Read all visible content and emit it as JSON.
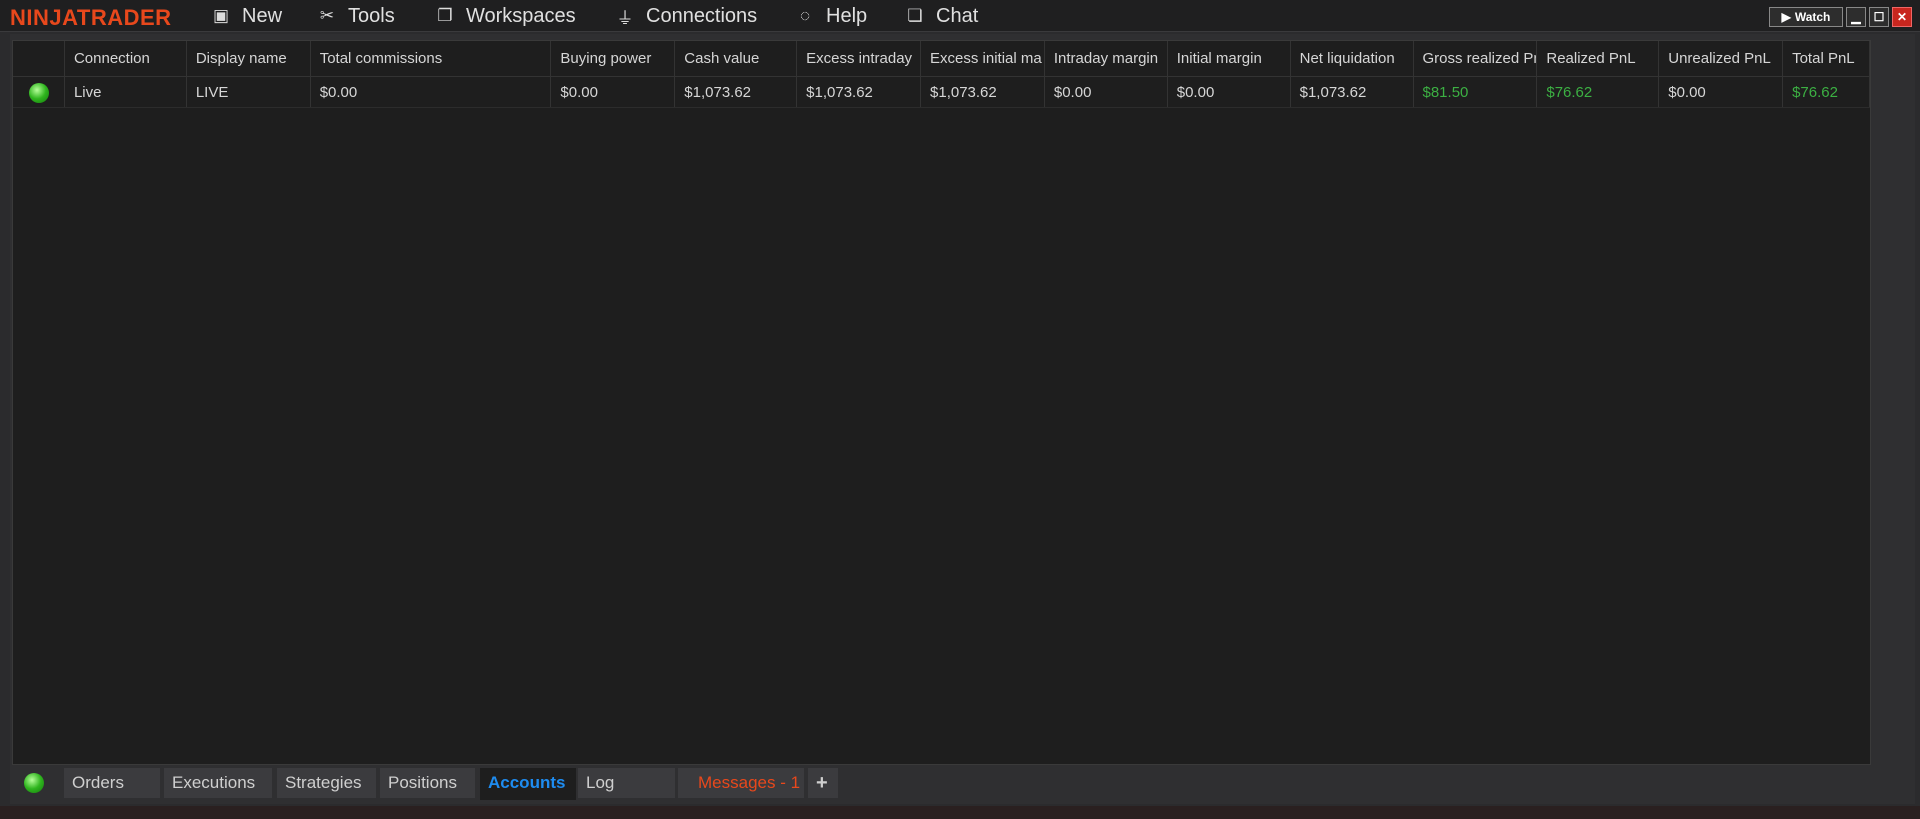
{
  "app": {
    "logo": "NINJATRADER"
  },
  "menu": [
    {
      "label": "New",
      "icon": "new-window-icon"
    },
    {
      "label": "Tools",
      "icon": "tools-icon"
    },
    {
      "label": "Workspaces",
      "icon": "workspaces-icon"
    },
    {
      "label": "Connections",
      "icon": "plug-icon"
    },
    {
      "label": "Help",
      "icon": "lifebuoy-icon"
    },
    {
      "label": "Chat",
      "icon": "chat-icon"
    }
  ],
  "window": {
    "watch_label": "Watch"
  },
  "table": {
    "columns": [
      "",
      "Connection",
      "Display name",
      "Total commissions",
      "Buying power",
      "Cash value",
      "Excess intraday",
      "Excess initial ma",
      "Intraday margin",
      "Initial margin",
      "Net liquidation",
      "Gross realized PnL",
      "Realized PnL",
      "Unrealized PnL",
      "Total PnL"
    ],
    "rows": [
      {
        "status": "connected",
        "cells": [
          "",
          "Live",
          "LIVE",
          "$0.00",
          "$0.00",
          "$1,073.62",
          "$1,073.62",
          "$1,073.62",
          "$0.00",
          "$0.00",
          "$1,073.62",
          "$81.50",
          "$76.62",
          "$0.00",
          "$76.62"
        ]
      }
    ],
    "positive_color": "#3cb043"
  },
  "tabs": [
    {
      "label": "Orders"
    },
    {
      "label": "Executions"
    },
    {
      "label": "Strategies"
    },
    {
      "label": "Positions"
    },
    {
      "label": "Accounts",
      "active": true
    },
    {
      "label": "Log"
    },
    {
      "label": "Messages - 1"
    },
    {
      "label": "+"
    }
  ]
}
